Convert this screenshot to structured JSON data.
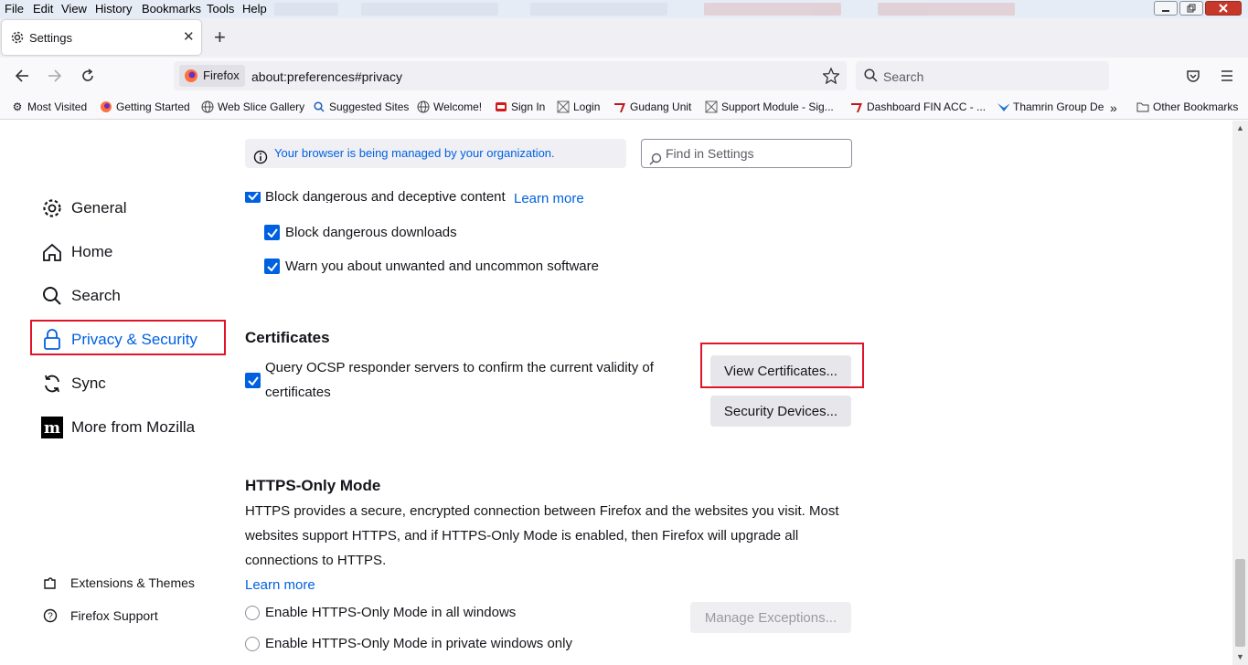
{
  "menubar": {
    "items": [
      "File",
      "Edit",
      "View",
      "History",
      "Bookmarks",
      "Tools",
      "Help"
    ]
  },
  "tab": {
    "title": "Settings"
  },
  "navbar": {
    "identity_label": "Firefox",
    "url": "about:preferences#privacy",
    "search_placeholder": "Search"
  },
  "bookmarks": {
    "items": [
      "Most Visited",
      "Getting Started",
      "Web Slice Gallery",
      "Suggested Sites",
      "Welcome!",
      "Sign In",
      "Login",
      "Gudang Unit",
      "Support Module - Sig...",
      "Dashboard FIN ACC - ...",
      "Thamrin Group De"
    ],
    "other": "Other Bookmarks"
  },
  "sidebar": {
    "items": [
      "General",
      "Home",
      "Search",
      "Privacy & Security",
      "Sync",
      "More from Mozilla"
    ],
    "footer": [
      "Extensions & Themes",
      "Firefox Support"
    ]
  },
  "content": {
    "managed_note": "Your browser is being managed by your organization.",
    "find_placeholder": "Find in Settings",
    "block_dangerous": "Block dangerous and deceptive content",
    "learn_more": "Learn more",
    "block_downloads": "Block dangerous downloads",
    "warn_unwanted": "Warn you about unwanted and uncommon software",
    "certificates_heading": "Certificates",
    "ocsp_line1": "Query OCSP responder servers to confirm the current validity of",
    "ocsp_line2": "certificates",
    "view_certificates": "View Certificates...",
    "security_devices": "Security Devices...",
    "https_heading": "HTTPS-Only Mode",
    "https_line1": "HTTPS provides a secure, encrypted connection between Firefox and the websites you visit. Most",
    "https_line2": "websites support HTTPS, and if HTTPS-Only Mode is enabled, then Firefox will upgrade all",
    "https_line3": "connections to HTTPS.",
    "https_learn_more": "Learn more",
    "https_all_windows": "Enable HTTPS-Only Mode in all windows",
    "https_private_only": "Enable HTTPS-Only Mode in private windows only",
    "manage_exceptions": "Manage Exceptions..."
  },
  "colors": {
    "accent": "#0061e0",
    "highlight": "#e0152a"
  }
}
